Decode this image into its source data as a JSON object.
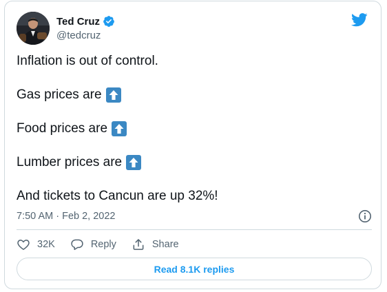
{
  "author": {
    "display_name": "Ted Cruz",
    "handle": "@tedcruz",
    "verified": true,
    "avatar_icon": "user-avatar"
  },
  "brand": {
    "logo_icon": "twitter-bird-icon",
    "accent_color": "#1d9bf0"
  },
  "tweet": {
    "lines": [
      "Inflation is out of control.",
      "Gas prices are",
      "Food prices are",
      "Lumber prices are",
      "And tickets to Cancun are up 32%!"
    ],
    "emoji": "up-arrow-emoji"
  },
  "meta": {
    "timestamp": "7:50 AM · Feb 2, 2022",
    "info_icon": "info-icon"
  },
  "actions": {
    "like_count": "32K",
    "reply_label": "Reply",
    "share_label": "Share"
  },
  "footer": {
    "read_replies_label": "Read 8.1K replies"
  }
}
